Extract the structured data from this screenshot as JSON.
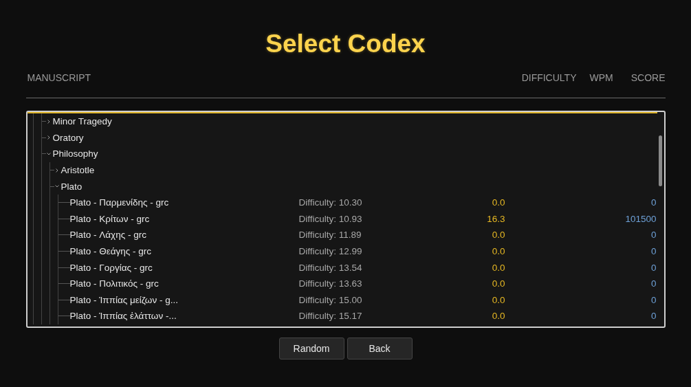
{
  "title": "Select Codex",
  "columns": {
    "manuscript": "MANUSCRIPT",
    "difficulty": "DIFFICULTY",
    "wpm": "WPM",
    "score": "SCORE"
  },
  "tree": [
    {
      "kind": "group",
      "label": "Minor Tragedy",
      "expanded": false
    },
    {
      "kind": "group",
      "label": "Oratory",
      "expanded": false
    },
    {
      "kind": "group",
      "label": "Philosophy",
      "expanded": true,
      "children": [
        {
          "kind": "group",
          "label": "Aristotle",
          "expanded": false
        },
        {
          "kind": "group",
          "label": "Plato",
          "expanded": true,
          "children": [
            {
              "kind": "leaf",
              "name": "Plato - Παρμενίδης - grc",
              "difficulty": "Difficulty: 10.30",
              "wpm": "0.0",
              "score": "0"
            },
            {
              "kind": "leaf",
              "name": "Plato - Κρίτων - grc",
              "difficulty": "Difficulty: 10.93",
              "wpm": "16.3",
              "score": "101500"
            },
            {
              "kind": "leaf",
              "name": "Plato - Λάχης - grc",
              "difficulty": "Difficulty: 11.89",
              "wpm": "0.0",
              "score": "0"
            },
            {
              "kind": "leaf",
              "name": "Plato - Θεάγης - grc",
              "difficulty": "Difficulty: 12.99",
              "wpm": "0.0",
              "score": "0"
            },
            {
              "kind": "leaf",
              "name": "Plato - Γοργίας - grc",
              "difficulty": "Difficulty: 13.54",
              "wpm": "0.0",
              "score": "0"
            },
            {
              "kind": "leaf",
              "name": "Plato - Πολιτικός - grc",
              "difficulty": "Difficulty: 13.63",
              "wpm": "0.0",
              "score": "0"
            },
            {
              "kind": "leaf",
              "name": "Plato - Ἱππίας μείζων - g...",
              "difficulty": "Difficulty: 15.00",
              "wpm": "0.0",
              "score": "0"
            },
            {
              "kind": "leaf",
              "name": "Plato - Ἱππίας ἐλάττων -...",
              "difficulty": "Difficulty: 15.17",
              "wpm": "0.0",
              "score": "0"
            }
          ]
        }
      ]
    }
  ],
  "buttons": [
    "Random",
    "Back"
  ]
}
